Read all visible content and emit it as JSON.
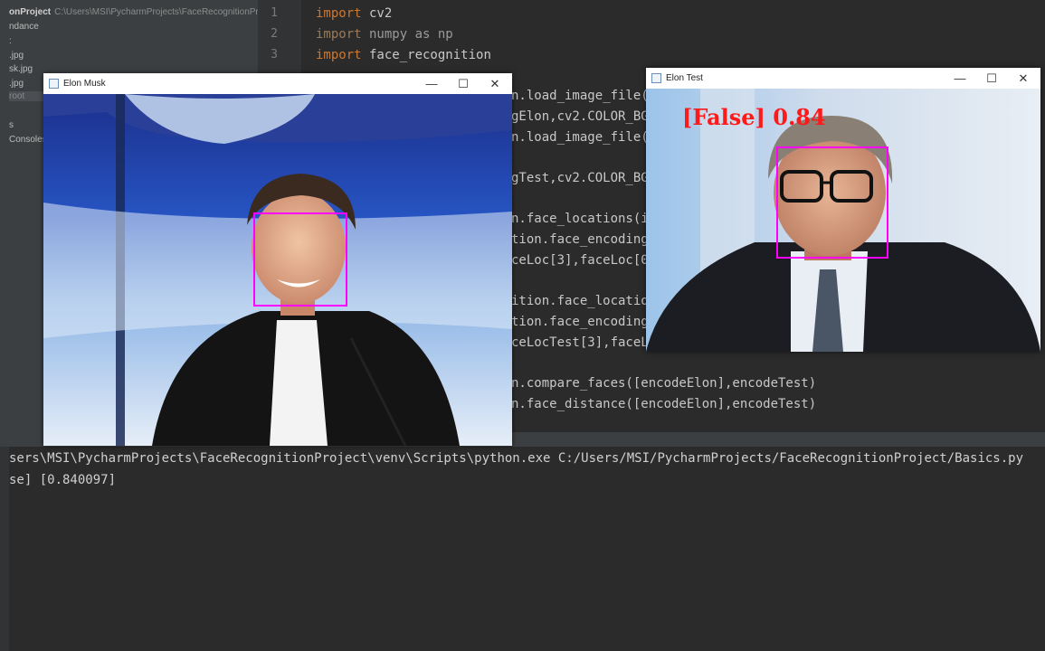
{
  "project": {
    "name": "onProject",
    "path": "C:\\Users\\MSI\\PycharmProjects\\FaceRecognitionProject",
    "items": [
      "ndance",
      ":",
      ".jpg",
      "sk.jpg",
      ".jpg",
      "root",
      "s",
      "Consoles"
    ]
  },
  "editor": {
    "line_numbers": [
      "1",
      "2",
      "3"
    ],
    "code_lines": [
      {
        "kw": "import",
        "rest": " cv2"
      },
      {
        "kw": "import",
        "rest": " numpy as np"
      },
      {
        "kw": "import",
        "rest": " face_recognition"
      }
    ],
    "partial_lines": [
      "n.load_image_file(",
      "gElon,cv2.COLOR_BG",
      "n.load_image_file(",
      "gTest,cv2.COLOR_BG",
      "n.face_locations(i",
      "tion.face_encoding",
      "ceLoc[3],faceLoc[0",
      "ition.face_locatio",
      "tion.face_encoding",
      "ceLocTest[3],faceL",
      "n.compare_faces([encodeElon],encodeTest)",
      "n.face_distance([encodeElon],encodeTest)"
    ]
  },
  "console": {
    "command": "sers\\MSI\\PycharmProjects\\FaceRecognitionProject\\venv\\Scripts\\python.exe C:/Users/MSI/PycharmProjects/FaceRecognitionProject/Basics.py",
    "output": "se] [0.840097]"
  },
  "window_elon": {
    "title": "Elon Musk",
    "minimize": "—",
    "maximize": "☐",
    "close": "✕"
  },
  "window_test": {
    "title": "Elon Test",
    "overlay": "[False] 0.84",
    "minimize": "—",
    "maximize": "☐",
    "close": "✕"
  },
  "colors": {
    "face_box": "#ff00ff",
    "overlay_text": "#ff1a1a",
    "keyword": "#cc7832"
  }
}
